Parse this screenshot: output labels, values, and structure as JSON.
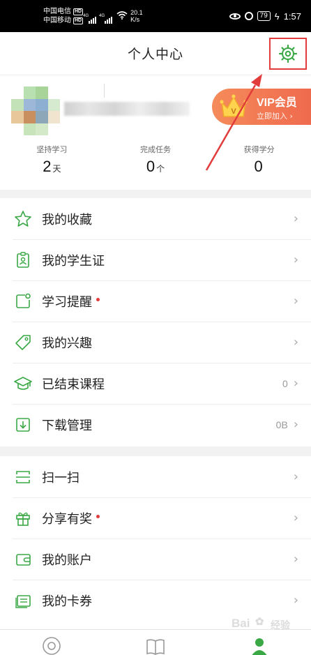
{
  "status_bar": {
    "carrier_1": "中国电信",
    "carrier_2": "中国移动",
    "hd_badge": "HD",
    "network_tag": "4G",
    "speed_value": "20.1",
    "speed_unit": "K/s",
    "battery": "79",
    "time": "1:57"
  },
  "header": {
    "title": "个人中心",
    "settings_icon": "gear-icon"
  },
  "profile": {
    "vip": {
      "title": "VIP会员",
      "subtitle": "立即加入 ›",
      "crown_letter": "V"
    },
    "stats": [
      {
        "label": "坚持学习",
        "value": "2",
        "unit": "天"
      },
      {
        "label": "完成任务",
        "value": "0",
        "unit": "个"
      },
      {
        "label": "获得学分",
        "value": "0",
        "unit": ""
      }
    ]
  },
  "menu_group_1": [
    {
      "label": "我的收藏",
      "icon": "star-icon",
      "value": "",
      "dot": false
    },
    {
      "label": "我的学生证",
      "icon": "student-card-icon",
      "value": "",
      "dot": false
    },
    {
      "label": "学习提醒",
      "icon": "reminder-icon",
      "value": "",
      "dot": true
    },
    {
      "label": "我的兴趣",
      "icon": "tag-icon",
      "value": "",
      "dot": false
    },
    {
      "label": "已结束课程",
      "icon": "graduation-cap-icon",
      "value": "0",
      "dot": false
    },
    {
      "label": "下载管理",
      "icon": "download-icon",
      "value": "0B",
      "dot": false
    }
  ],
  "menu_group_2": [
    {
      "label": "扫一扫",
      "icon": "scan-icon",
      "value": "",
      "dot": false
    },
    {
      "label": "分享有奖",
      "icon": "gift-icon",
      "value": "",
      "dot": true
    },
    {
      "label": "我的账户",
      "icon": "wallet-icon",
      "value": "",
      "dot": false
    },
    {
      "label": "我的卡券",
      "icon": "coupon-icon",
      "value": "",
      "dot": false
    }
  ],
  "chevron": "›",
  "watermark": {
    "text": "Bai",
    "text2": "经验"
  },
  "colors": {
    "accent_green": "#3aa845",
    "annotation_red": "#e23b3b",
    "vip_orange": "#ef6a4e"
  }
}
